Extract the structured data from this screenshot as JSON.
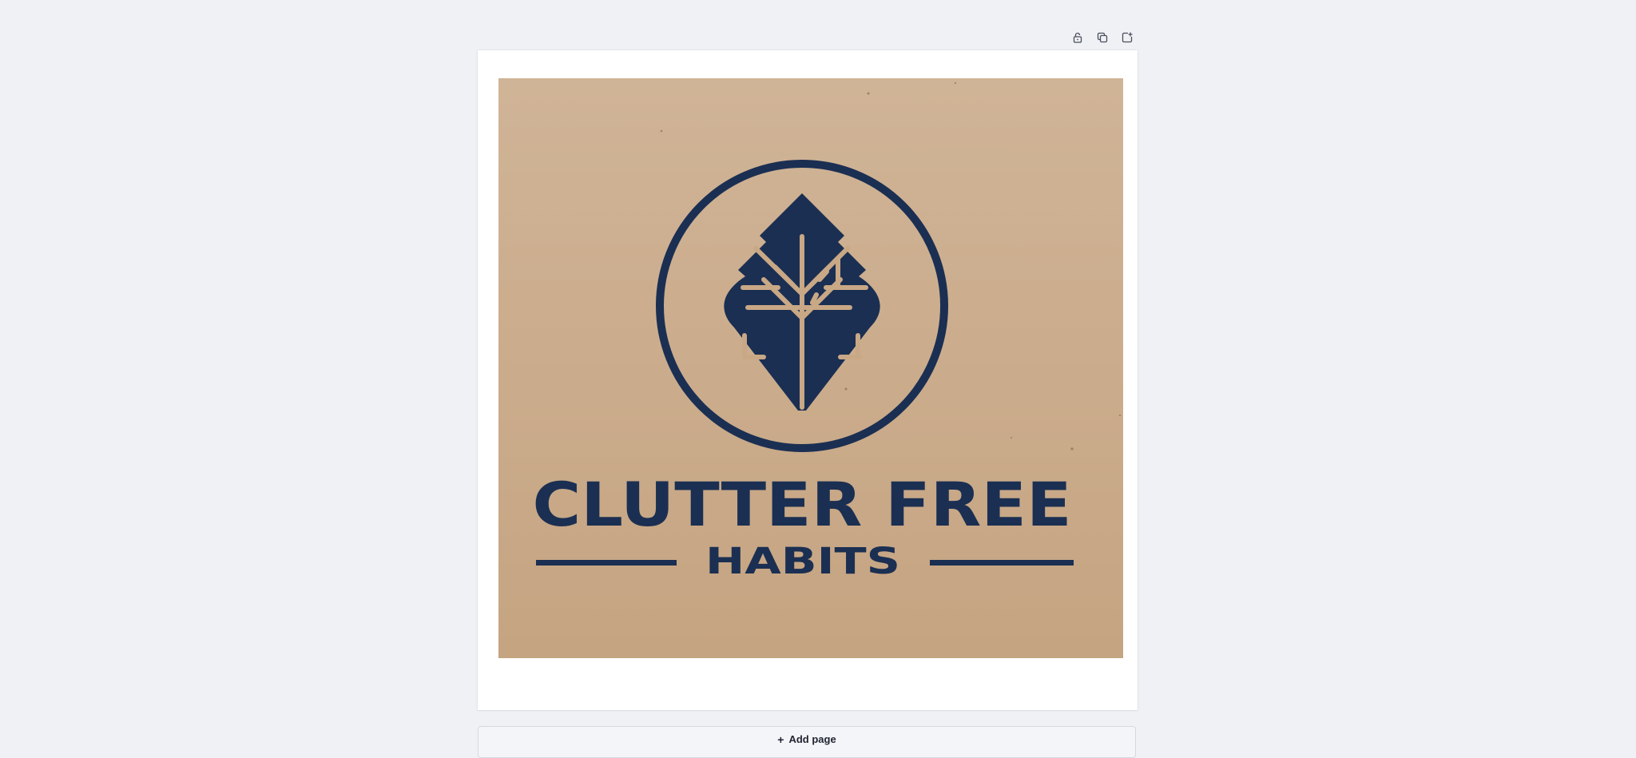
{
  "toolbar": {
    "icons": [
      "lock-icon",
      "duplicate-icon",
      "add-page-icon"
    ]
  },
  "design": {
    "logo_line1": "CLUTTER FREE",
    "logo_line2": "HABITS",
    "colors": {
      "navy": "#1b2f52",
      "tan": "#c9a886"
    }
  },
  "add_page": {
    "label": "Add page",
    "icon": "plus-icon"
  }
}
